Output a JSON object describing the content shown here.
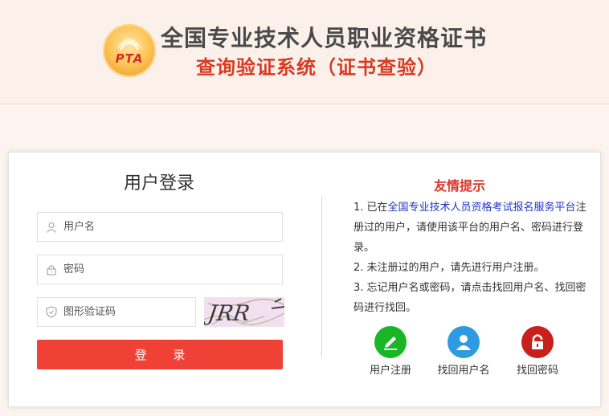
{
  "header": {
    "title": "全国专业技术人员职业资格证书",
    "subtitle": "查询验证系统（证书查验）",
    "logo_text": "PTA"
  },
  "login": {
    "title": "用户登录",
    "username_placeholder": "用户名",
    "password_placeholder": "密码",
    "captcha_placeholder": "图形验证码",
    "captcha_text": "JRR",
    "submit_label": "登 录"
  },
  "tips": {
    "title": "友情提示",
    "item1_prefix": "1. 已在",
    "item1_link": "全国专业技术人员资格考试报名服务平台",
    "item1_suffix": "注册过的用户，请使用该平台的用户名、密码进行登录。",
    "item2": "2. 未注册过的用户，请先进行用户注册。",
    "item3": "3. 忘记用户名或密码，请点击找回用户名、找回密码进行找回。"
  },
  "actions": {
    "register": "用户注册",
    "recover_username": "找回用户名",
    "recover_password": "找回密码"
  },
  "colors": {
    "accent": "#ef4135",
    "title_red": "#d83a23",
    "register_green": "#19b626",
    "user_blue": "#2e9be0",
    "lock_red": "#c8201a"
  }
}
